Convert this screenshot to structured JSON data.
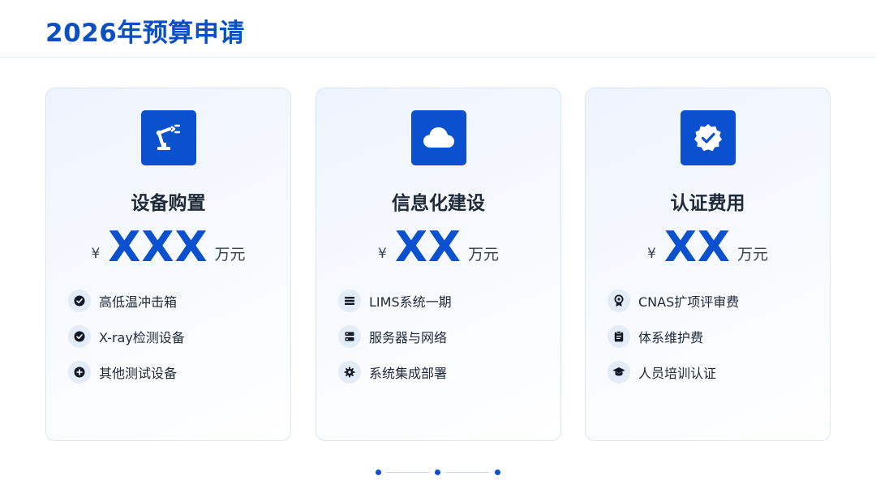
{
  "header": {
    "title": "2026年预算申请"
  },
  "cards": [
    {
      "icon": "robot-arm-icon",
      "title": "设备购置",
      "currency": "¥",
      "amount": "XXX",
      "unit": "万元",
      "items": [
        {
          "icon": "check-circle-icon",
          "label": "高低温冲击箱"
        },
        {
          "icon": "check-circle-icon",
          "label": "X-ray检测设备"
        },
        {
          "icon": "plus-circle-icon",
          "label": "其他测试设备"
        }
      ]
    },
    {
      "icon": "cloud-icon",
      "title": "信息化建设",
      "currency": "¥",
      "amount": "XX",
      "unit": "万元",
      "items": [
        {
          "icon": "list-icon",
          "label": "LIMS系统一期"
        },
        {
          "icon": "server-icon",
          "label": "服务器与网络"
        },
        {
          "icon": "gear-icon",
          "label": "系统集成部署"
        }
      ]
    },
    {
      "icon": "badge-check-icon",
      "title": "认证费用",
      "currency": "¥",
      "amount": "XX",
      "unit": "万元",
      "items": [
        {
          "icon": "award-icon",
          "label": "CNAS扩项评审费"
        },
        {
          "icon": "clipboard-icon",
          "label": "体系维护费"
        },
        {
          "icon": "graduation-cap-icon",
          "label": "人员培训认证"
        }
      ]
    }
  ],
  "colors": {
    "accent": "#0b50cf",
    "title": "#0b4fc4",
    "card_border": "#dbe6f5",
    "bullet_bg": "#e4ecf8"
  },
  "pagination": {
    "dots": 3
  }
}
